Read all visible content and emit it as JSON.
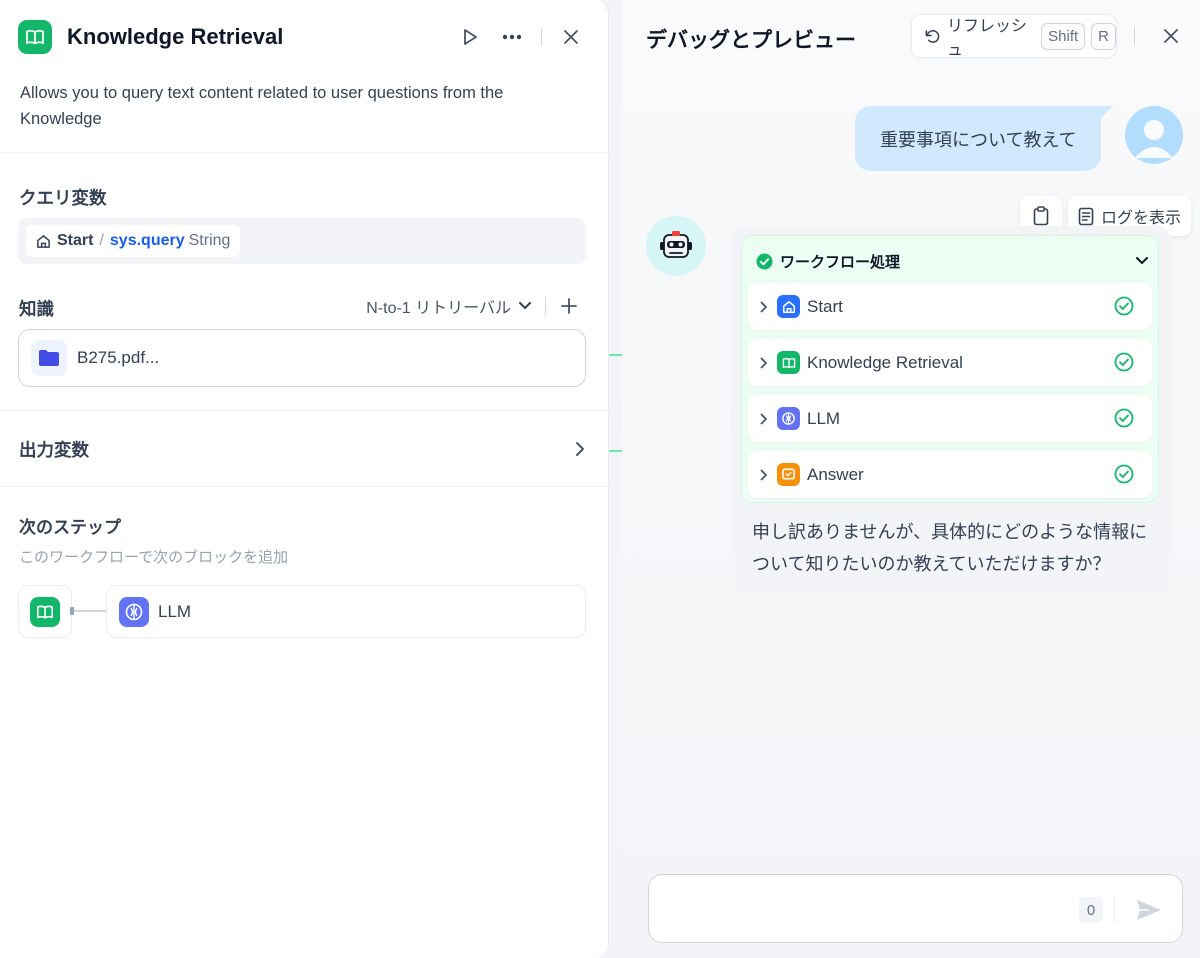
{
  "node_panel": {
    "title": "Knowledge Retrieval",
    "description": "Allows you to query text content related to user questions from the Knowledge",
    "query_variable": {
      "label": "クエリ変数",
      "source_node": "Start",
      "separator": "/",
      "variable": "sys.query",
      "type": "String"
    },
    "knowledge": {
      "label": "知識",
      "retrieval_mode": "N-to-1 リトリーバル",
      "add_icon": "plus-icon",
      "files": [
        {
          "name": "B275.pdf..."
        }
      ]
    },
    "output": {
      "label": "出力変数"
    },
    "next_step": {
      "label": "次のステップ",
      "description": "このワークフローで次のブロックを追加",
      "target": "LLM"
    }
  },
  "debug_panel": {
    "title": "デバッグとプレビュー",
    "refresh": {
      "label": "リフレッシュ",
      "keys": [
        "Shift",
        "R"
      ]
    },
    "user_message": "重要事項について教えて",
    "view_log_label": "ログを表示",
    "workflow": {
      "label": "ワークフロー処理",
      "status": "success",
      "nodes": [
        {
          "name": "Start",
          "icon": "home-icon",
          "color": "#2970ff"
        },
        {
          "name": "Knowledge Retrieval",
          "icon": "book-icon",
          "color": "#12b76a"
        },
        {
          "name": "LLM",
          "icon": "llm-icon",
          "color": "#6172f3"
        },
        {
          "name": "Answer",
          "icon": "answer-icon",
          "color": "#f79009"
        }
      ]
    },
    "answer": "申し訳ありませんが、具体的にどのような情報について知りたいのか教えていただけますか？",
    "input": {
      "value": "",
      "char_count": "0"
    }
  },
  "colors": {
    "accent_blue": "#155eef",
    "success_green": "#12b76a",
    "user_bubble": "#d1e9ff"
  }
}
